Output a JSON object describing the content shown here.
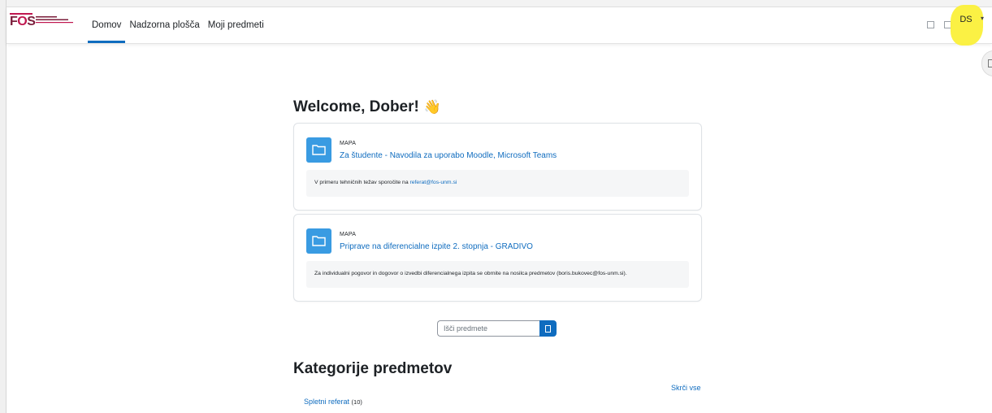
{
  "brand": {
    "logo_text_f": "F",
    "logo_text_o": "O",
    "logo_text_s": "S"
  },
  "navbar": {
    "links": [
      {
        "label": "Domov",
        "active": true
      },
      {
        "label": "Nadzorna plošča",
        "active": false
      },
      {
        "label": "Moji predmeti",
        "active": false
      }
    ],
    "icons": [
      "notification-icon",
      "message-icon"
    ],
    "avatar_initials": "DS"
  },
  "main": {
    "welcome": "Welcome, Dober!",
    "welcome_icon": "👋",
    "cards": [
      {
        "kind": "MAPA",
        "title": "Za študente - Navodila za uporabo Moodle, Microsoft Teams",
        "desc_prefix": "V primeru tehničnih težav sporočite na ",
        "desc_link": "referat@fos-unm.si",
        "desc_suffix": ""
      },
      {
        "kind": "MAPA",
        "title": "Priprave na diferencialne izpite 2. stopnja - GRADIVO",
        "desc_prefix": "Za individualni pogovor in dogovor o izvedbi diferencialnega izpita se obrnite na nosilca predmetov (boris.bukovec@fos-unm.si).",
        "desc_link": "",
        "desc_suffix": ""
      }
    ],
    "search": {
      "placeholder": "Išči predmete"
    },
    "categories": {
      "heading": "Kategorije predmetov",
      "collapse_all": "Skrči vse",
      "items": [
        {
          "label": "Spletni referat",
          "count": "(10)"
        }
      ]
    }
  },
  "colors": {
    "accent": "#0f6cbf",
    "folder": "#399be2",
    "highlight": "#fbf03a",
    "brand": "#7a1c3a"
  }
}
